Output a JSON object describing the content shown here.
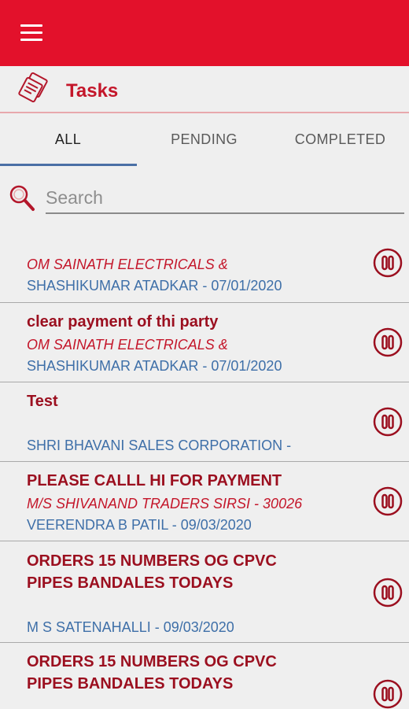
{
  "appbar": {
    "menu_icon": "hamburger-menu-icon",
    "accent": "#e3112b"
  },
  "header": {
    "title": "Tasks",
    "icon": "tasks-document-icon"
  },
  "tabs": [
    {
      "label": "ALL",
      "active": true
    },
    {
      "label": "PENDING",
      "active": false
    },
    {
      "label": "COMPLETED",
      "active": false
    }
  ],
  "search": {
    "placeholder": "Search",
    "value": ""
  },
  "tasks": [
    {
      "title": "",
      "party": "OM SAINATH ELECTRICALS &",
      "meta": "SHASHIKUMAR ATADKAR - 07/01/2020"
    },
    {
      "title": "clear payment of thi party",
      "party": "OM SAINATH ELECTRICALS &",
      "meta": "SHASHIKUMAR ATADKAR - 07/01/2020"
    },
    {
      "title": "Test",
      "party": "",
      "meta": "SHRI BHAVANI SALES CORPORATION -"
    },
    {
      "title": "PLEASE CALLL HI FOR  PAYMENT",
      "party": "M/S SHIVANAND TRADERS SIRSI - 30026",
      "meta": "VEERENDRA B PATIL - 09/03/2020"
    },
    {
      "title_lines": [
        "ORDERS 15 NUMBERS OG CPVC",
        "PIPES BANDALES TODAYS"
      ],
      "party": "",
      "meta": "M S SATENAHALLI - 09/03/2020"
    },
    {
      "title_lines": [
        "ORDERS 15 NUMBERS OG CPVC",
        "PIPES BANDALES TODAYS"
      ],
      "party": "",
      "meta": ""
    }
  ],
  "colors": {
    "title": "#9b0f1f",
    "party": "#c4162a",
    "meta": "#3e6fa8"
  }
}
